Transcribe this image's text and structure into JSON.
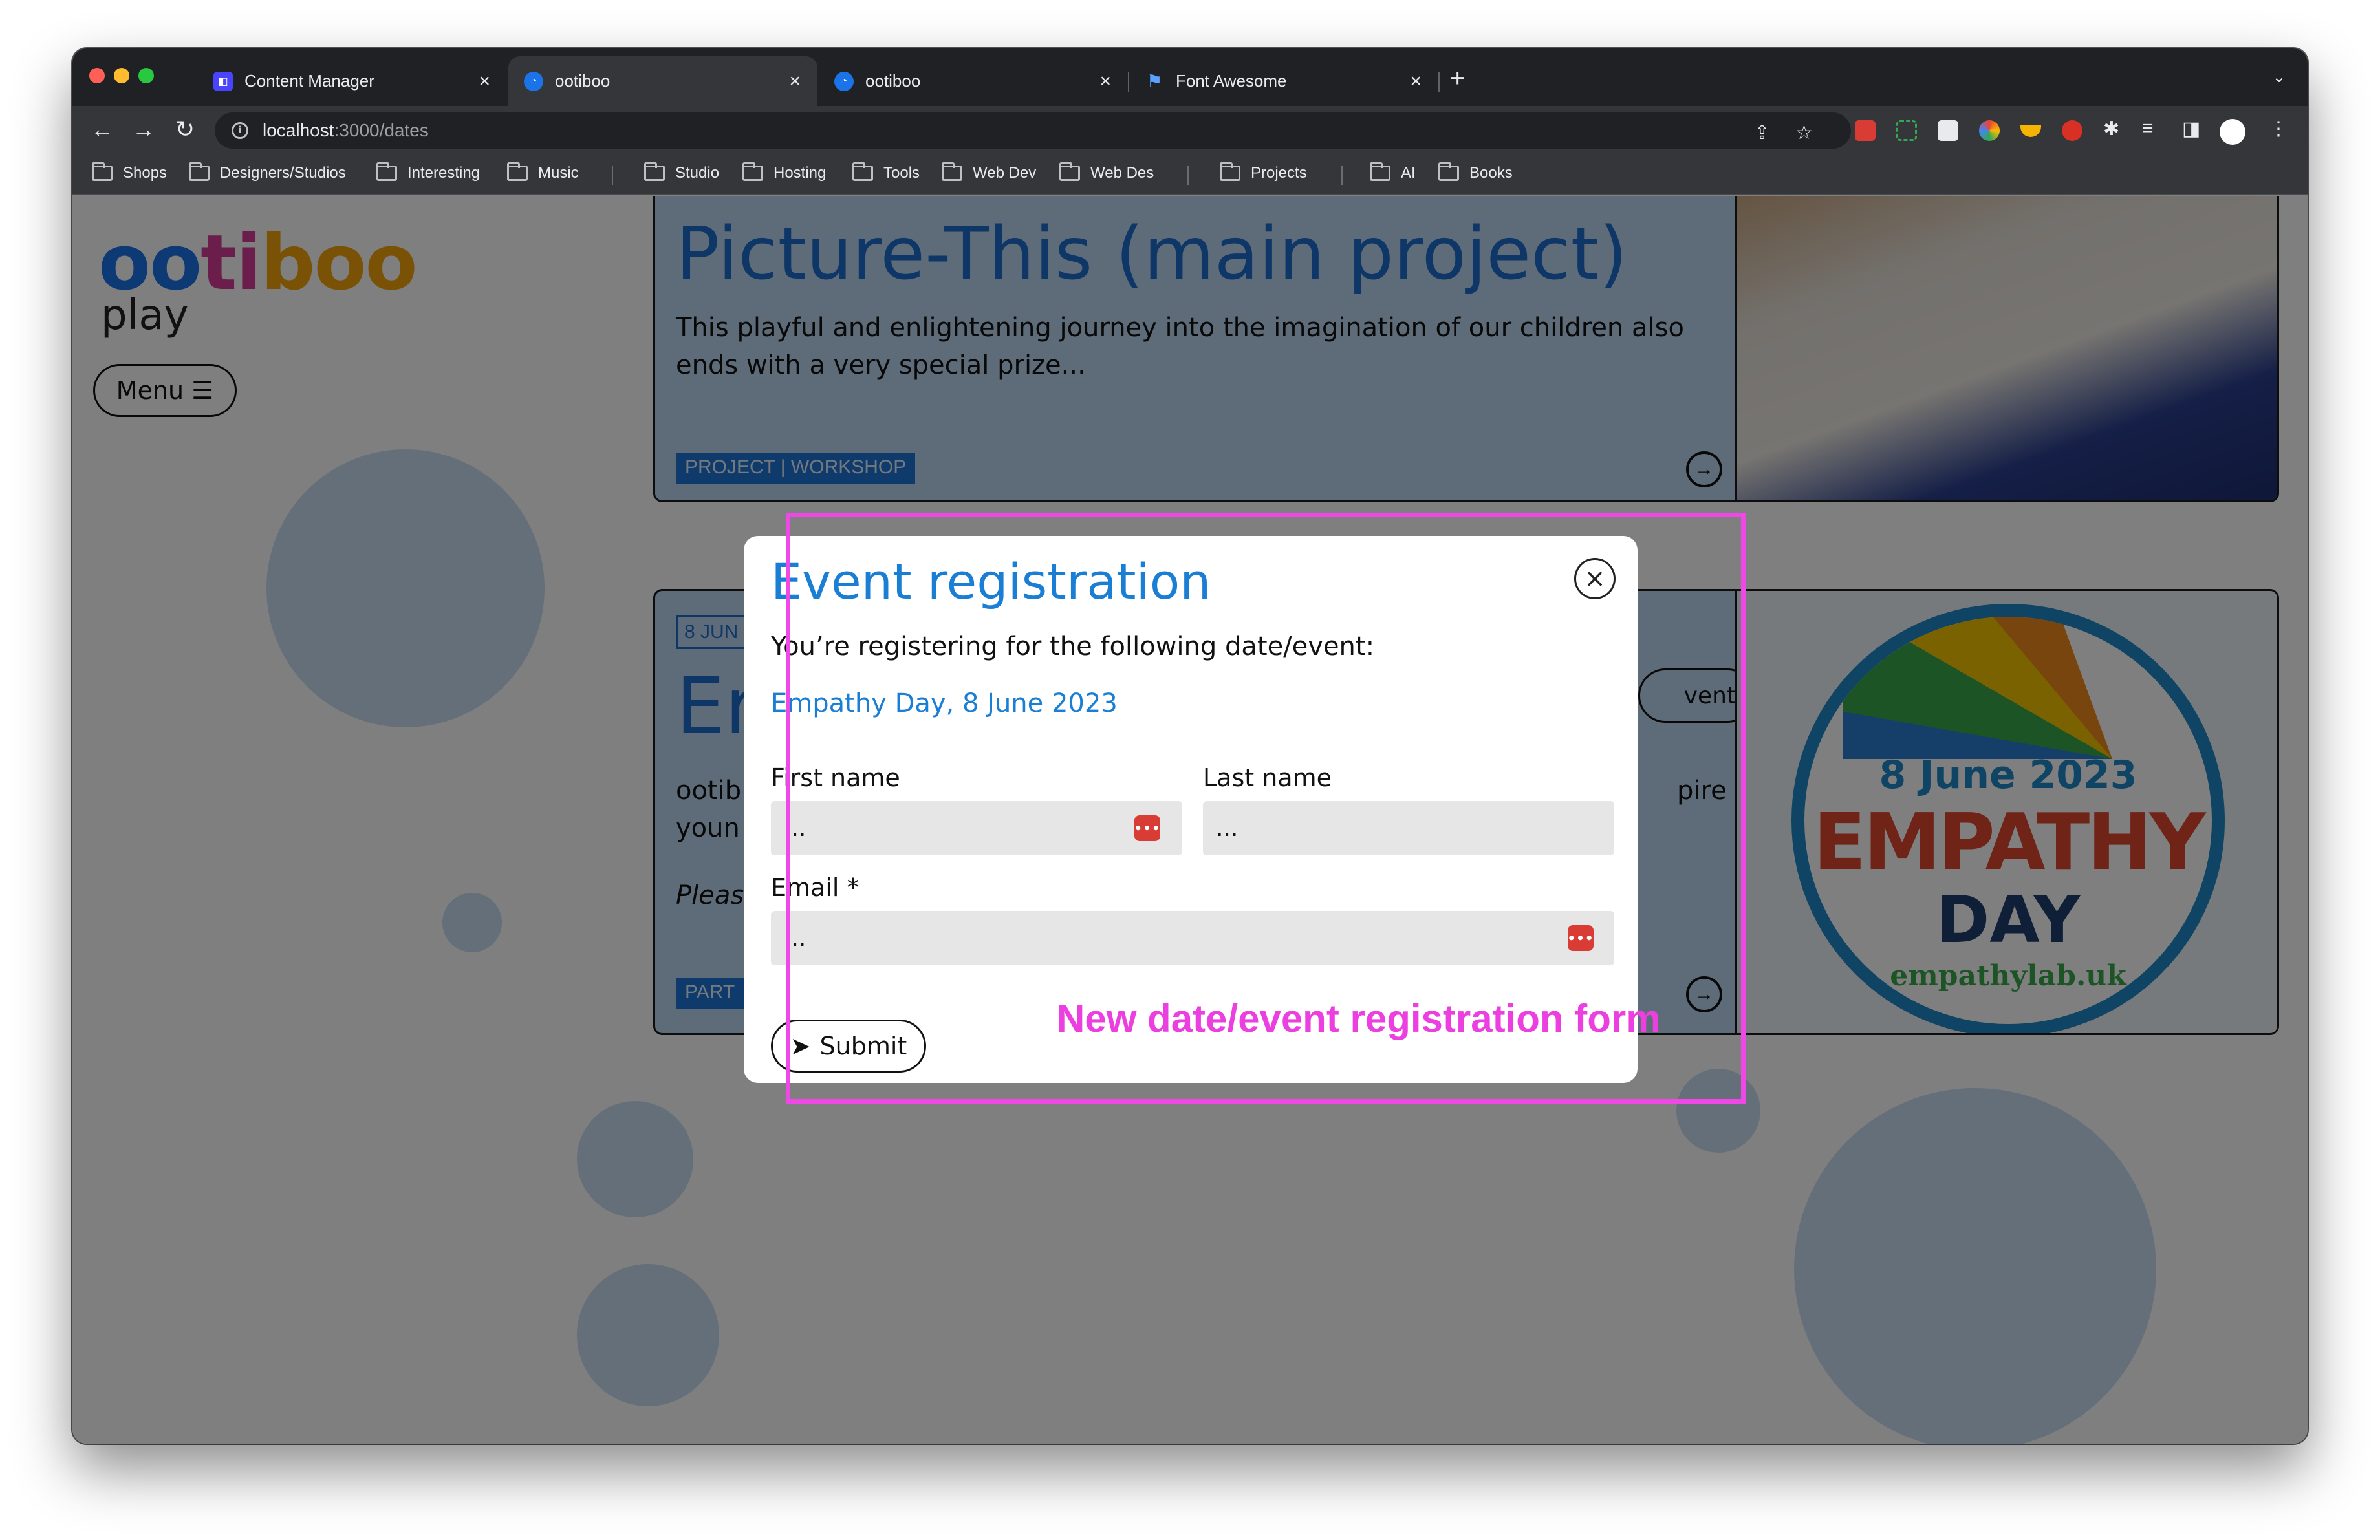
{
  "browser": {
    "tabs": [
      {
        "title": "Content Manager",
        "active": false,
        "favicon": "content-manager-icon"
      },
      {
        "title": "ootiboo",
        "active": true,
        "favicon": "ootiboo-icon"
      },
      {
        "title": "ootiboo",
        "active": false,
        "favicon": "ootiboo-icon"
      },
      {
        "title": "Font Awesome",
        "active": false,
        "favicon": "flag-icon"
      }
    ],
    "url_host": "localhost",
    "url_path": ":3000/dates",
    "bookmarks": [
      "Shops",
      "Designers/Studios",
      "Interesting",
      "Music",
      "Studio",
      "Hosting",
      "Tools",
      "Web Dev",
      "Web Des",
      "Projects",
      "AI",
      "Books"
    ]
  },
  "page": {
    "logo_word": "ootiboo",
    "logo_sub": "play",
    "menu_label": "Menu",
    "card1": {
      "title": "Picture-This (main project)",
      "text": "This playful and enlightening journey into the imagination of our children also ends with a very special prize...",
      "tag": "PROJECT | WORKSHOP"
    },
    "card2": {
      "date_fragment": "8 JUN",
      "heading_fragment": "Er",
      "event_btn_fragment": "vent",
      "text_fragment_1": "ootib",
      "text_fragment_2": "youn",
      "text_fragment_3": "Pleas",
      "text_fragment_right": "pire",
      "tag_fragment": "PART",
      "image": {
        "date": "8 June 2023",
        "title_line1": "EMPATHY",
        "title_line2": "DAY",
        "site": "empathylab.uk"
      }
    }
  },
  "modal": {
    "title": "Event registration",
    "intro": "You’re registering for the following date/event:",
    "event": "Empathy Day, 8 June 2023",
    "first_name_label": "First name",
    "first_name_value": "...",
    "last_name_label": "Last name",
    "last_name_value": "...",
    "email_label": "Email *",
    "email_value": "...",
    "submit_label": "Submit"
  },
  "annotation": {
    "text": "New date/event registration form",
    "color": "#f048e6"
  },
  "colors": {
    "brand_blue": "#1a7fd4",
    "overlay": "rgba(0,0,0,0.5)"
  }
}
